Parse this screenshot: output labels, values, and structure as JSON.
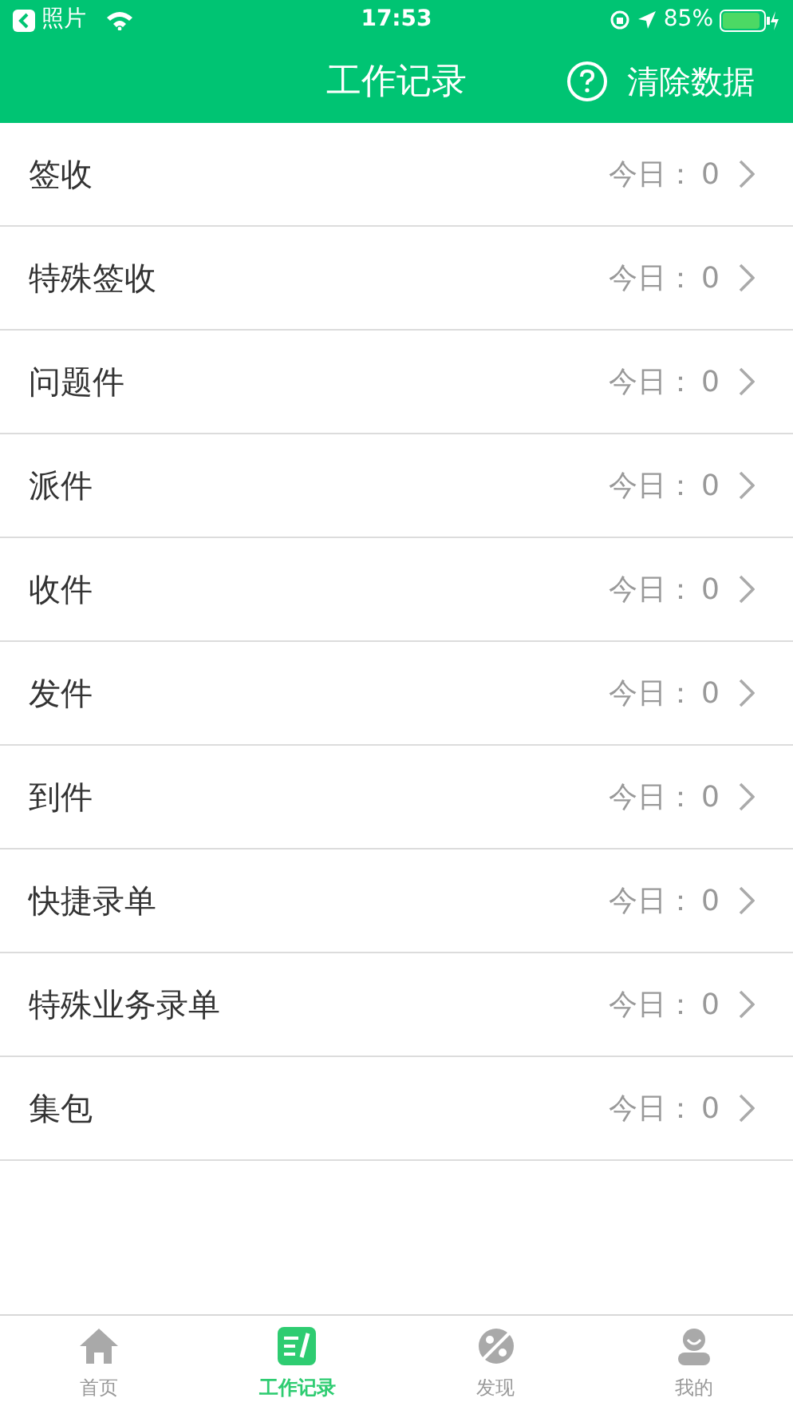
{
  "status_bar": {
    "back_app": "照片",
    "time": "17:53",
    "battery": "85%"
  },
  "header": {
    "title": "工作记录",
    "action": "清除数据"
  },
  "rows": [
    {
      "label": "签收",
      "count_label": "今日：",
      "count": "0"
    },
    {
      "label": "特殊签收",
      "count_label": "今日：",
      "count": "0"
    },
    {
      "label": "问题件",
      "count_label": "今日：",
      "count": "0"
    },
    {
      "label": "派件",
      "count_label": "今日：",
      "count": "0"
    },
    {
      "label": "收件",
      "count_label": "今日：",
      "count": "0"
    },
    {
      "label": "发件",
      "count_label": "今日：",
      "count": "0"
    },
    {
      "label": "到件",
      "count_label": "今日：",
      "count": "0"
    },
    {
      "label": "快捷录单",
      "count_label": "今日：",
      "count": "0"
    },
    {
      "label": "特殊业务录单",
      "count_label": "今日：",
      "count": "0"
    },
    {
      "label": "集包",
      "count_label": "今日：",
      "count": "0"
    }
  ],
  "tabs": [
    {
      "kind": "home",
      "label": "首页",
      "selected": false
    },
    {
      "kind": "records",
      "label": "工作记录",
      "selected": true
    },
    {
      "kind": "discover",
      "label": "发现",
      "selected": false
    },
    {
      "kind": "me",
      "label": "我的",
      "selected": false
    }
  ]
}
